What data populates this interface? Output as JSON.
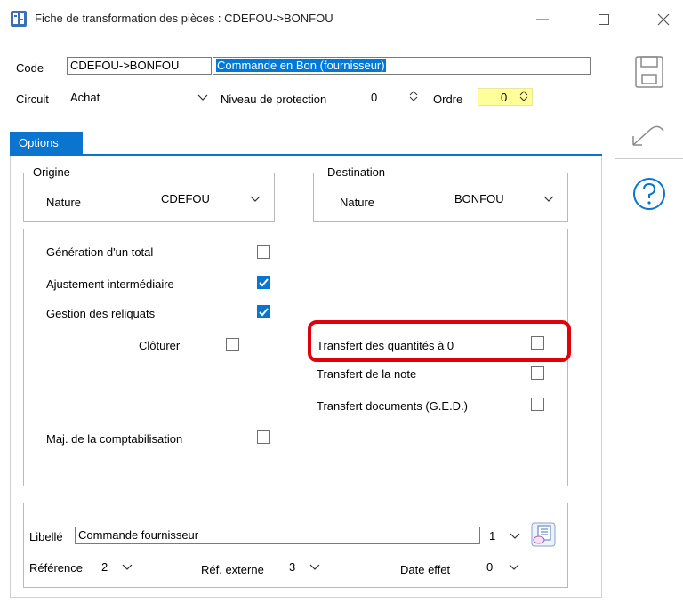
{
  "window": {
    "title": "Fiche de transformation des pièces : CDEFOU->BONFOU"
  },
  "header": {
    "code_label": "Code",
    "code_value": "CDEFOU->BONFOU",
    "code_description": "Commande en Bon (fournisseur)",
    "circuit_label": "Circuit",
    "circuit_value": "Achat",
    "protection_label": "Niveau de protection",
    "protection_value": "0",
    "ordre_label": "Ordre",
    "ordre_value": "0"
  },
  "tabs": [
    {
      "label": "Options",
      "active": true
    }
  ],
  "origine": {
    "legend": "Origine",
    "nature_label": "Nature",
    "nature_value": "CDEFOU"
  },
  "destination": {
    "legend": "Destination",
    "nature_label": "Nature",
    "nature_value": "BONFOU"
  },
  "options": {
    "generation_total": {
      "label": "Génération d'un total",
      "checked": false
    },
    "ajustement": {
      "label": "Ajustement intermédiaire",
      "checked": true
    },
    "reliquats": {
      "label": "Gestion des reliquats",
      "checked": true
    },
    "cloturer": {
      "label": "Clôturer",
      "checked": false
    },
    "transfert_quantites": {
      "label": "Transfert des quantités à 0",
      "checked": false
    },
    "transfert_note": {
      "label": "Transfert de la note",
      "checked": false
    },
    "transfert_documents": {
      "label": "Transfert documents (G.E.D.)",
      "checked": false
    },
    "maj_compta": {
      "label": "Maj. de la comptabilisation",
      "checked": false
    }
  },
  "bottom": {
    "libelle_label": "Libellé",
    "libelle_value": "Commande fournisseur",
    "libelle_combo": "1",
    "reference_label": "Référence",
    "reference_value": "2",
    "ref_externe_label": "Réf. externe",
    "ref_externe_value": "3",
    "date_effet_label": "Date effet",
    "date_effet_value": "0"
  },
  "icons": {
    "app": "app-icon",
    "minimize": "minimize-icon",
    "maximize": "maximize-icon",
    "close": "close-icon",
    "save": "save-icon",
    "undo": "undo-icon",
    "help": "help-icon",
    "libelle_picker": "list-picker-icon"
  },
  "colors": {
    "accent": "#0a74cf",
    "highlight": "#e0000a",
    "ordre_bg": "#ffff99"
  }
}
